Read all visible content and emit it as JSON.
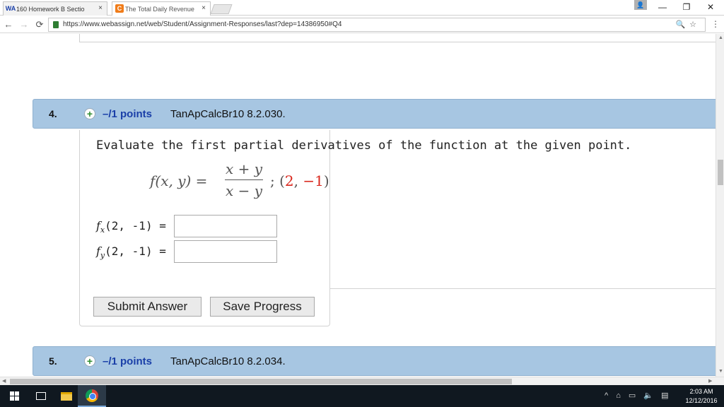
{
  "browser": {
    "tabs": [
      {
        "favicon": "WA",
        "label": "160 Homework B Sectio",
        "close": "×"
      },
      {
        "favicon": "C",
        "label": "The Total Daily Revenue",
        "close": "×"
      }
    ],
    "window_controls": {
      "minimize": "—",
      "restore": "❐",
      "close": "✕"
    },
    "nav": {
      "back": "←",
      "forward": "→",
      "reload": "⟳"
    },
    "url": "https://www.webassign.net/web/Student/Assignment-Responses/last?dep=14386950#Q4",
    "omnibox_icons": "🔍☆",
    "menu": "⋮"
  },
  "question4": {
    "number": "4.",
    "points": "–/1 points",
    "id": "TanApCalcBr10 8.2.030.",
    "prompt": "Evaluate the first partial derivatives of the function at the given point.",
    "formula": {
      "lhs": "f(x, y) =",
      "numerator": "x + y",
      "denominator": "x − y",
      "separator": "; (",
      "point_x": "2",
      "point_comma": ", ",
      "point_y": "−1",
      "point_close": ")"
    },
    "answers": [
      {
        "fn": "f",
        "sub": "x",
        "args": "(2, -1) =",
        "value": ""
      },
      {
        "fn": "f",
        "sub": "y",
        "args": "(2, -1) =",
        "value": ""
      }
    ],
    "submit_label": "Submit Answer",
    "save_label": "Save Progress"
  },
  "question5": {
    "number": "5.",
    "points": "–/1 points",
    "id": "TanApCalcBr10 8.2.034."
  },
  "taskbar": {
    "time": "2:03 AM",
    "date": "12/12/2016",
    "tray_icons": "^ ⌂ ▭ 🔈 ▤"
  }
}
